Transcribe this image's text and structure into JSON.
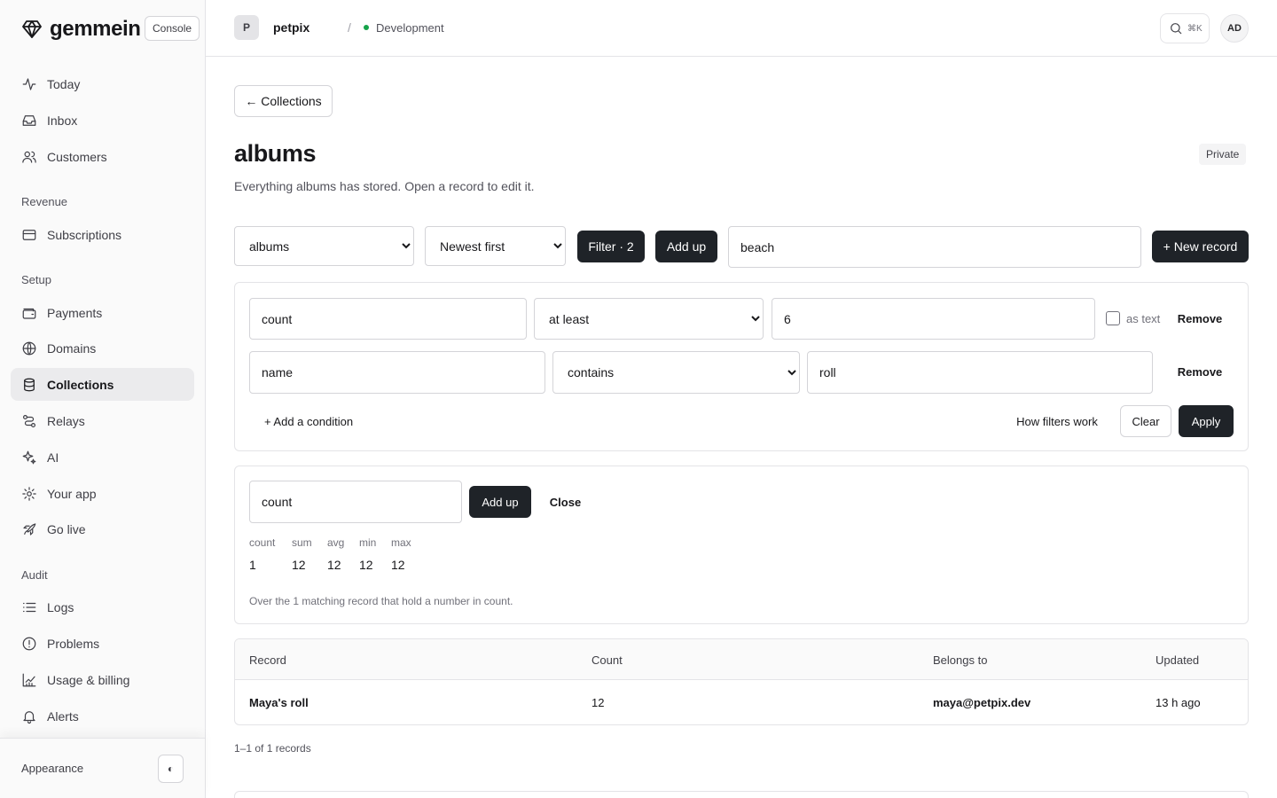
{
  "brand": {
    "name": "gemmein",
    "tag": "Console"
  },
  "nav": {
    "primary": [
      {
        "label": "Today",
        "icon": "activity-icon"
      },
      {
        "label": "Inbox",
        "icon": "inbox-icon"
      },
      {
        "label": "Customers",
        "icon": "users-icon"
      }
    ],
    "revenue_label": "Revenue",
    "revenue": [
      {
        "label": "Subscriptions",
        "icon": "credit-card-icon"
      }
    ],
    "setup_label": "Setup",
    "setup": [
      {
        "label": "Payments",
        "icon": "wallet-icon"
      },
      {
        "label": "Domains",
        "icon": "globe-icon"
      },
      {
        "label": "Collections",
        "icon": "database-icon",
        "active": true
      },
      {
        "label": "Relays",
        "icon": "route-icon"
      },
      {
        "label": "AI",
        "icon": "sparkles-icon"
      },
      {
        "label": "Your app",
        "icon": "gear-icon"
      },
      {
        "label": "Go live",
        "icon": "rocket-icon"
      }
    ],
    "audit_label": "Audit",
    "audit": [
      {
        "label": "Logs",
        "icon": "list-icon"
      },
      {
        "label": "Problems",
        "icon": "alert-circle-icon"
      },
      {
        "label": "Usage & billing",
        "icon": "chart-icon"
      },
      {
        "label": "Alerts",
        "icon": "bell-icon"
      }
    ],
    "appearance_label": "Appearance",
    "theme_toggle": "◐"
  },
  "topbar": {
    "project_initial": "P",
    "project_name": "petpix",
    "separator": "/",
    "environment": "Development",
    "search_shortcut": "⌘K",
    "user_initials": "AD"
  },
  "page": {
    "back_label": "← Collections",
    "title": "albums",
    "subtitle": "Everything albums has stored. Open a record to edit it.",
    "visibility": "Private"
  },
  "toolbar": {
    "collection_select": "albums",
    "sort_select": "Newest first",
    "filter_label": "Filter · 2",
    "add_up_label": "Add up",
    "search_value": "beach",
    "new_record_label": "+ New record"
  },
  "filters": {
    "conditions": [
      {
        "field": "count",
        "operator": "at least",
        "value": "6",
        "as_text_label": "as text",
        "remove_label": "Remove"
      },
      {
        "field": "name",
        "operator": "contains",
        "value": "roll",
        "remove_label": "Remove"
      }
    ],
    "add_condition_label": "+ Add a condition",
    "how_label": "How filters work",
    "clear_label": "Clear",
    "apply_label": "Apply"
  },
  "aggregate": {
    "field_value": "count",
    "add_up_label": "Add up",
    "close_label": "Close",
    "stats": [
      {
        "label": "count",
        "value": "1"
      },
      {
        "label": "sum",
        "value": "12"
      },
      {
        "label": "avg",
        "value": "12"
      },
      {
        "label": "min",
        "value": "12"
      },
      {
        "label": "max",
        "value": "12"
      }
    ],
    "note": "Over the 1 matching record that hold a number in count."
  },
  "table": {
    "headers": [
      "Record",
      "Count",
      "Belongs to",
      "Updated"
    ],
    "rows": [
      {
        "record": "Maya's roll",
        "count": "12",
        "belongs_to": "maya@petpix.dev",
        "updated": "13 h ago"
      }
    ]
  },
  "pagination": {
    "text": "1–1 of 1 records"
  },
  "colors": {
    "accent_dark": "#1f2328",
    "env_dot": "#16a34a",
    "active_nav": "#ebebed"
  }
}
